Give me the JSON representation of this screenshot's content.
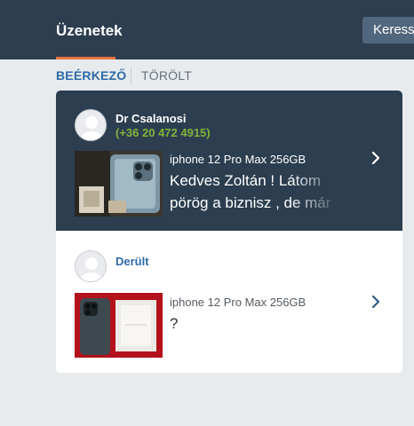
{
  "header": {
    "title": "Üzenetek",
    "search_label": "Keress"
  },
  "tabs": [
    {
      "label": "BEÉRKEZŐ",
      "active": true
    },
    {
      "label": "TÖRÖLT",
      "active": false
    }
  ],
  "conversations": [
    {
      "sender": "Dr Csalanosi",
      "phone": "(+36 20 472 4915)",
      "subject": "iphone 12 Pro Max 256GB",
      "message": "Kedves Zoltán ! Látom pörög a biznisz , de már",
      "unread": true
    },
    {
      "sender": "Derült",
      "subject": "iphone 12 Pro Max 256GB",
      "message": "?",
      "unread": false
    }
  ],
  "colors": {
    "header_bg": "#2c3e50",
    "accent": "#e8733a",
    "link_blue": "#2d6aa6",
    "phone_green": "#82b33b"
  }
}
